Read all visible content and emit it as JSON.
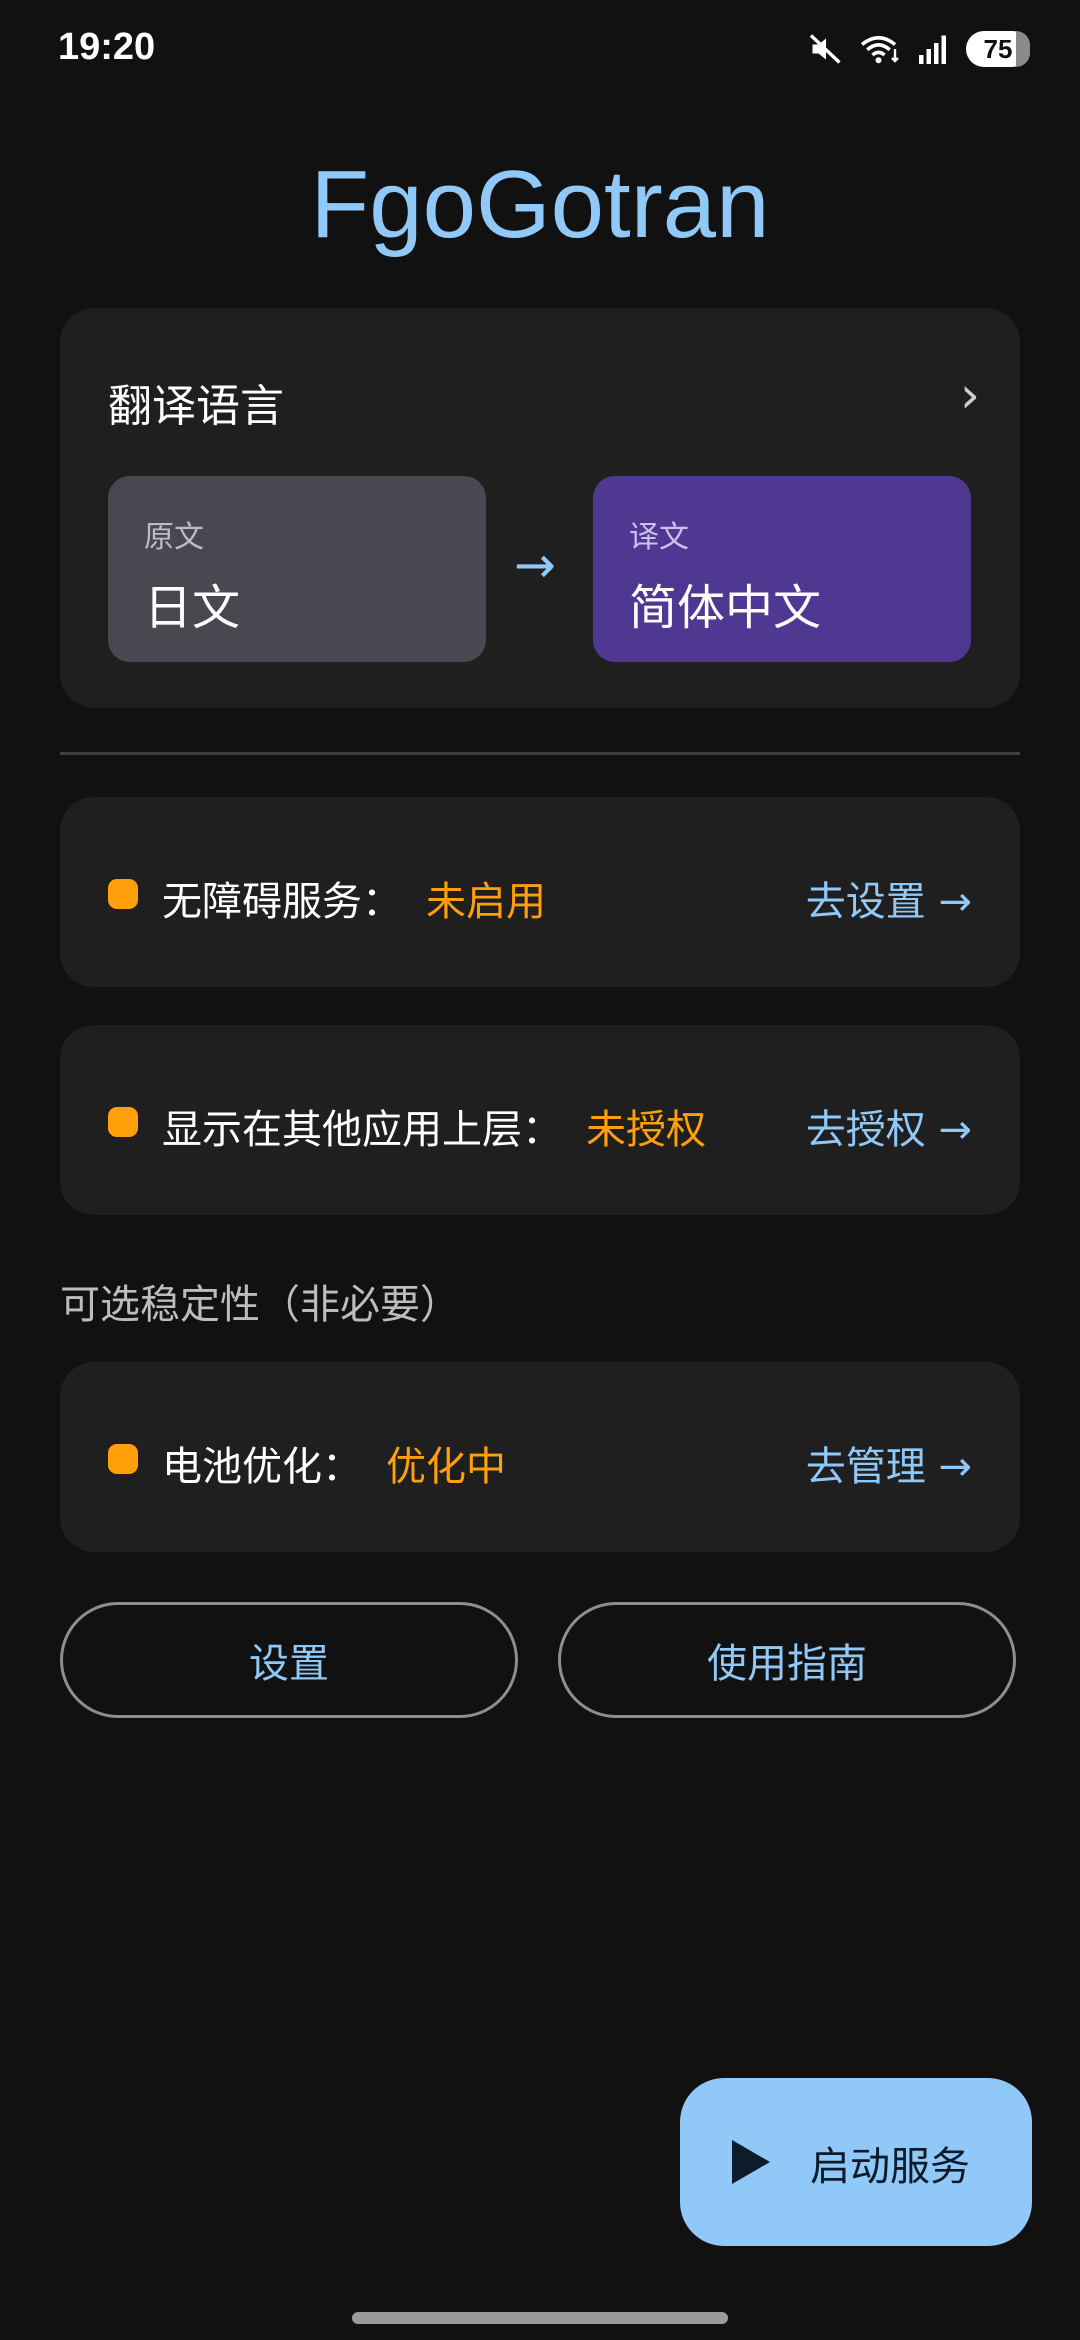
{
  "status_bar": {
    "time": "19:20",
    "battery": "75",
    "icons": [
      "mute-icon",
      "wifi-icon",
      "signal-icon",
      "battery-icon"
    ]
  },
  "app": {
    "title": "FgoGotran"
  },
  "language_card": {
    "header": "翻译语言",
    "chevron": "›",
    "source_label": "原文",
    "source_value": "日文",
    "arrow": "→",
    "target_label": "译文",
    "target_value": "简体中文"
  },
  "status_items": [
    {
      "label": "无障碍服务：",
      "value": "未启用",
      "action": "去设置 →"
    },
    {
      "label": "显示在其他应用上层：",
      "value": "未授权",
      "action": "去授权 →"
    },
    {
      "label": "电池优化：",
      "value": "优化中",
      "action": "去管理 →"
    }
  ],
  "optional_section": {
    "title": "可选稳定性（非必要）"
  },
  "buttons": {
    "settings": "设置",
    "guide": "使用指南"
  },
  "fab": {
    "label": "启动服务"
  },
  "colors": {
    "background": "#111111",
    "card": "#1f1f1f",
    "accent": "#90c8f8",
    "warning": "#ff9f0a",
    "target_box": "#4f3891",
    "source_box": "#4a4750"
  }
}
